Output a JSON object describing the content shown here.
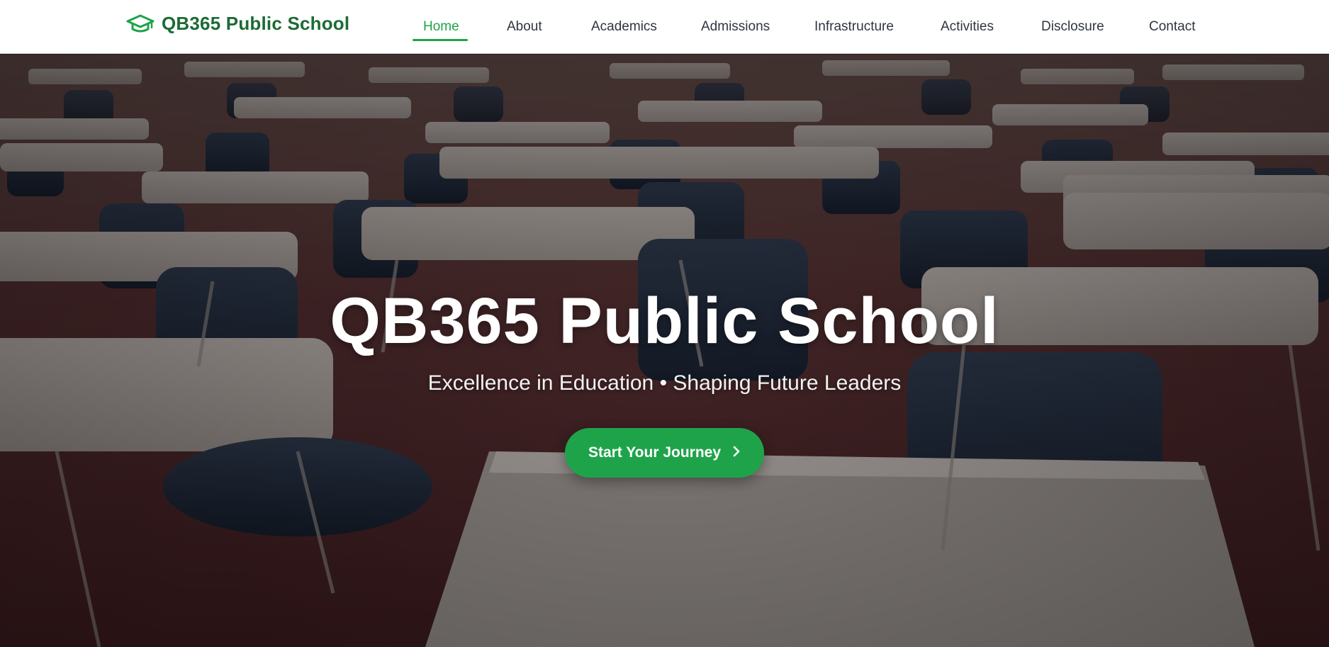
{
  "brand": {
    "name": "QB365 Public School",
    "icon": "graduation-cap-icon",
    "color": "#1c6b35"
  },
  "nav": {
    "items": [
      {
        "label": "Home",
        "active": true
      },
      {
        "label": "About"
      },
      {
        "label": "Academics"
      },
      {
        "label": "Admissions"
      },
      {
        "label": "Infrastructure"
      },
      {
        "label": "Activities"
      },
      {
        "label": "Disclosure"
      },
      {
        "label": "Contact"
      }
    ],
    "active_color": "#1fa34a"
  },
  "hero": {
    "title": "QB365 Public School",
    "subtitle": "Excellence in Education • Shaping Future Leaders",
    "cta_label": "Start Your Journey",
    "cta_icon": "chevron-right-icon",
    "background": "classroom-desks-photo",
    "cta_color": "#1fa34a"
  }
}
